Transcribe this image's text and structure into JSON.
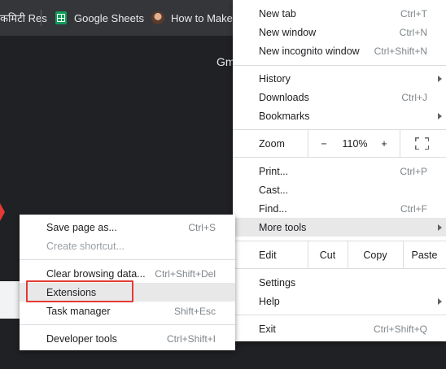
{
  "bookmarks": [
    {
      "label": "कमिटी Res"
    },
    {
      "label": "Google Sheets",
      "icon": "google-sheets-icon"
    },
    {
      "label": "How to Make",
      "icon": "avatar-icon"
    }
  ],
  "page": {
    "partial_text": "Gm"
  },
  "main_menu": {
    "new_tab": {
      "label": "New tab",
      "shortcut": "Ctrl+T"
    },
    "new_window": {
      "label": "New window",
      "shortcut": "Ctrl+N"
    },
    "new_incognito": {
      "label": "New incognito window",
      "shortcut": "Ctrl+Shift+N"
    },
    "history": {
      "label": "History"
    },
    "downloads": {
      "label": "Downloads",
      "shortcut": "Ctrl+J"
    },
    "bookmarks": {
      "label": "Bookmarks"
    },
    "zoom": {
      "label": "Zoom",
      "minus": "−",
      "value": "110%",
      "plus": "+"
    },
    "print": {
      "label": "Print...",
      "shortcut": "Ctrl+P"
    },
    "cast": {
      "label": "Cast..."
    },
    "find": {
      "label": "Find...",
      "shortcut": "Ctrl+F"
    },
    "more_tools": {
      "label": "More tools"
    },
    "edit": {
      "label": "Edit",
      "cut": "Cut",
      "copy": "Copy",
      "paste": "Paste"
    },
    "settings": {
      "label": "Settings"
    },
    "help": {
      "label": "Help"
    },
    "exit": {
      "label": "Exit",
      "shortcut": "Ctrl+Shift+Q"
    }
  },
  "sub_menu": {
    "save_page": {
      "label": "Save page as...",
      "shortcut": "Ctrl+S"
    },
    "create_shortcut": {
      "label": "Create shortcut..."
    },
    "clear_browsing": {
      "label": "Clear browsing data...",
      "shortcut": "Ctrl+Shift+Del"
    },
    "extensions": {
      "label": "Extensions"
    },
    "task_manager": {
      "label": "Task manager",
      "shortcut": "Shift+Esc"
    },
    "developer_tools": {
      "label": "Developer tools",
      "shortcut": "Ctrl+Shift+I"
    }
  },
  "colors": {
    "highlight_box": "#e53935",
    "hover_row": "#e8e8e9"
  }
}
